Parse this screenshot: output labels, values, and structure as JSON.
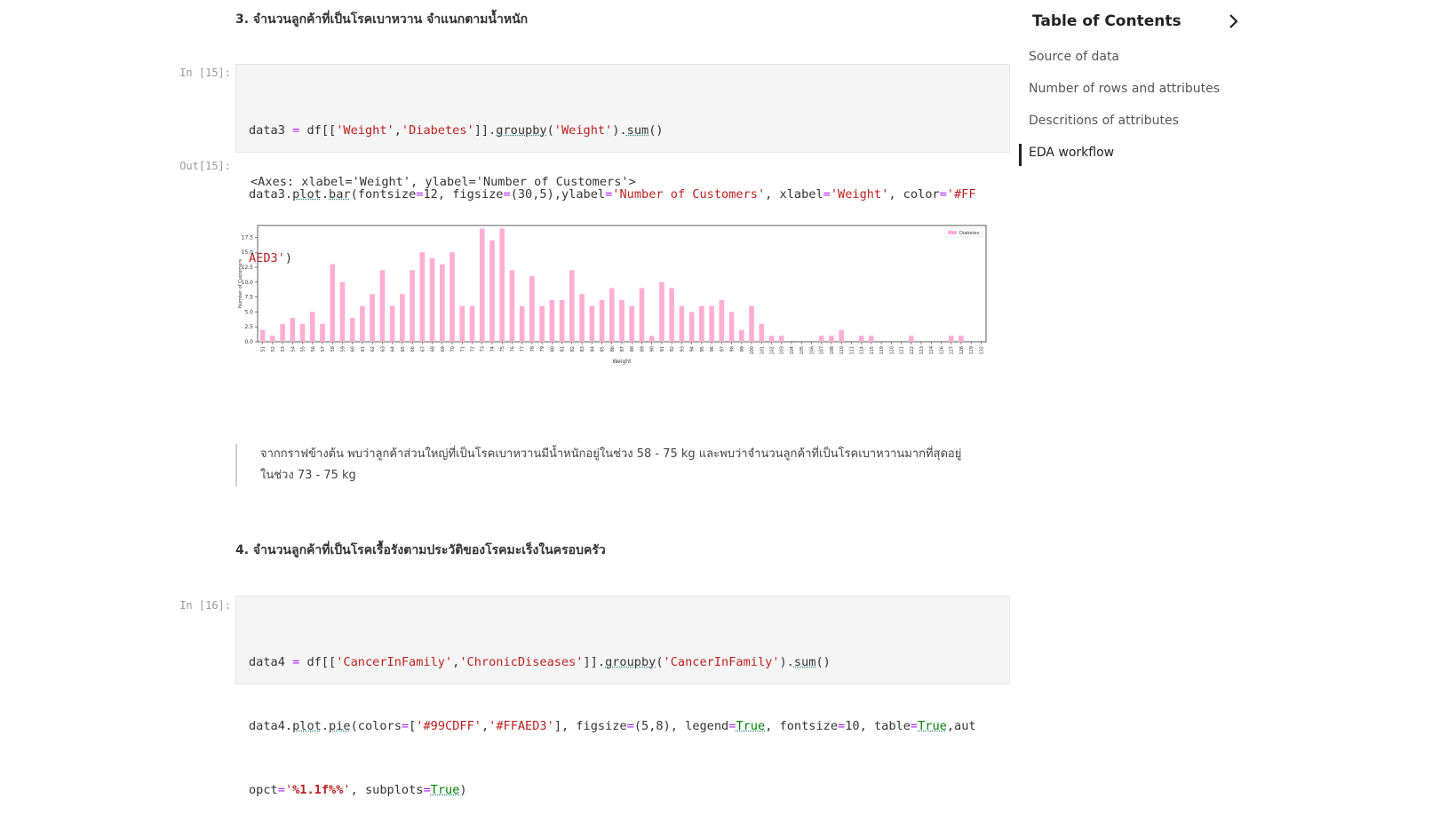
{
  "section3": {
    "heading": "3. จำนวนลูกค้าที่เป็นโรคเบาหวาน จำแนกตามน้ำหนัก"
  },
  "cell15": {
    "in_prompt": "In [15]:",
    "out_prompt": "Out[15]:",
    "output_text": "<Axes: xlabel='Weight', ylabel='Number of Customers'>"
  },
  "insight": {
    "line1": "จากกราฟข้างต้น พบว่าลูกค้าส่วนใหญ่ที่เป็นโรคเบาหวานมีน้ำหนักอยู่ในช่วง 58 - 75 kg และพบว่าจำนวนลูกค้าที่เป็นโรคเบาหวานมากที่สุดอยู่",
    "line2": "ในช่วง 73 - 75 kg"
  },
  "section4": {
    "heading": "4. จำนวนลูกค้าที่เป็นโรคเรื้อรังตามประวัติของโรคมะเร็งในครอบครัว"
  },
  "cell16": {
    "in_prompt": "In [16]:"
  },
  "toc": {
    "title": "Table of Contents",
    "chevron_icon": "chevron-right-icon",
    "items": [
      {
        "label": "Source of data"
      },
      {
        "label": "Number of rows and attributes"
      },
      {
        "label": "Descritions of attributes"
      },
      {
        "label": "EDA workflow"
      }
    ],
    "active_index": 3
  },
  "chart_data": {
    "type": "bar",
    "xlabel": "Weight",
    "ylabel": "Number of Customers",
    "ylim": [
      0,
      19.5
    ],
    "yticks": [
      0.0,
      2.5,
      5.0,
      7.5,
      10.0,
      12.5,
      15.0,
      17.5
    ],
    "legend": "top-right",
    "bar_color": "#FFAED3",
    "series": [
      {
        "name": "Diabetes"
      }
    ],
    "categories": [
      "51",
      "52",
      "53",
      "54",
      "55",
      "56",
      "57",
      "58",
      "59",
      "60",
      "61",
      "62",
      "63",
      "64",
      "65",
      "66",
      "67",
      "68",
      "69",
      "70",
      "71",
      "72",
      "73",
      "74",
      "75",
      "76",
      "77",
      "78",
      "79",
      "80",
      "81",
      "82",
      "83",
      "84",
      "85",
      "86",
      "87",
      "88",
      "89",
      "90",
      "91",
      "92",
      "93",
      "94",
      "95",
      "96",
      "97",
      "98",
      "99",
      "100",
      "101",
      "102",
      "103",
      "104",
      "105",
      "106",
      "107",
      "108",
      "110",
      "111",
      "114",
      "115",
      "119",
      "120",
      "121",
      "122",
      "123",
      "124",
      "126",
      "127",
      "128",
      "129",
      "132"
    ],
    "values": [
      2,
      1,
      3,
      4,
      3,
      5,
      3,
      13,
      10,
      4,
      6,
      8,
      12,
      6,
      8,
      12,
      15,
      14,
      13,
      15,
      6,
      6,
      19,
      17,
      19,
      12,
      6,
      11,
      6,
      7,
      7,
      12,
      8,
      6,
      7,
      9,
      7,
      6,
      9,
      1,
      10,
      9,
      6,
      5,
      6,
      6,
      7,
      5,
      2,
      6,
      3,
      1,
      1,
      0,
      0,
      0,
      1,
      1,
      2,
      0,
      1,
      1,
      0,
      0,
      0,
      1,
      0,
      0,
      0,
      1,
      1,
      0,
      0
    ]
  }
}
